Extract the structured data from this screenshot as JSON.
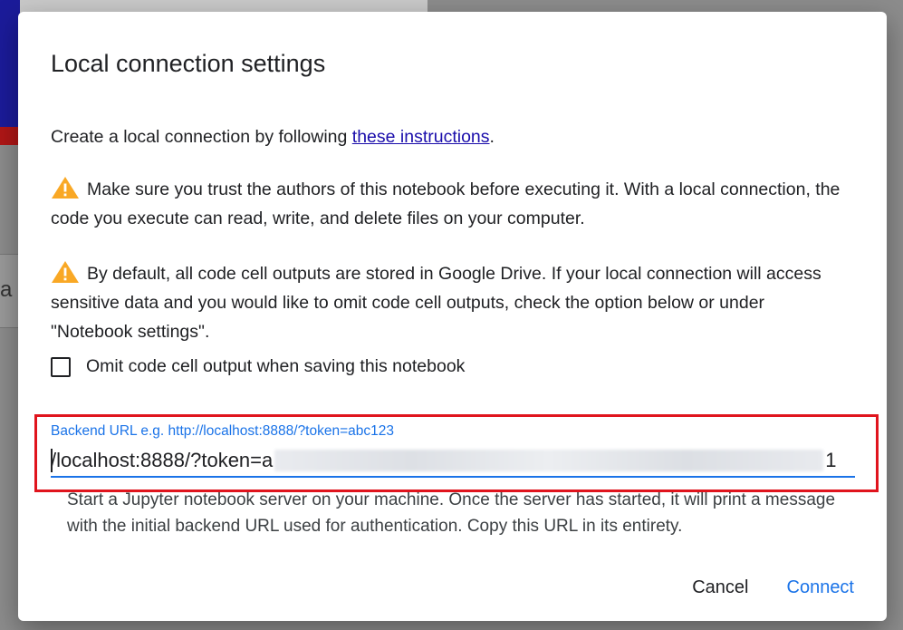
{
  "dialog": {
    "title": "Local connection settings",
    "intro_prefix": "Create a local connection by following ",
    "intro_link": "these instructions",
    "intro_suffix": ".",
    "warning1": "Make sure you trust the authors of this notebook before executing it. With a local connection, the code you execute can read, write, and delete files on your computer.",
    "warning2": "By default, all code cell outputs are stored in Google Drive. If your local connection will access sensitive data and you would like to omit code cell outputs, check the option below or under \"Notebook settings\".",
    "checkbox_label": "Omit code cell output when saving this notebook",
    "checkbox_checked": false,
    "url_field": {
      "label": "Backend URL e.g. http://localhost:8888/?token=abc123",
      "value_visible_start": "/localhost:8888/?token=a",
      "value_visible_end": "1"
    },
    "help_text": "Start a Jupyter notebook server on your machine. Once the server has started, it will print a message with the initial backend URL used for authentication. Copy this URL in its entirety.",
    "cancel_label": "Cancel",
    "connect_label": "Connect"
  },
  "background": {
    "partial_letter": "a"
  },
  "colors": {
    "accent": "#1a73e8",
    "warning": "#f9a825",
    "highlight": "#e0141d",
    "link": "#1a0dab"
  },
  "icons": {
    "warning": "warning-triangle-icon"
  }
}
